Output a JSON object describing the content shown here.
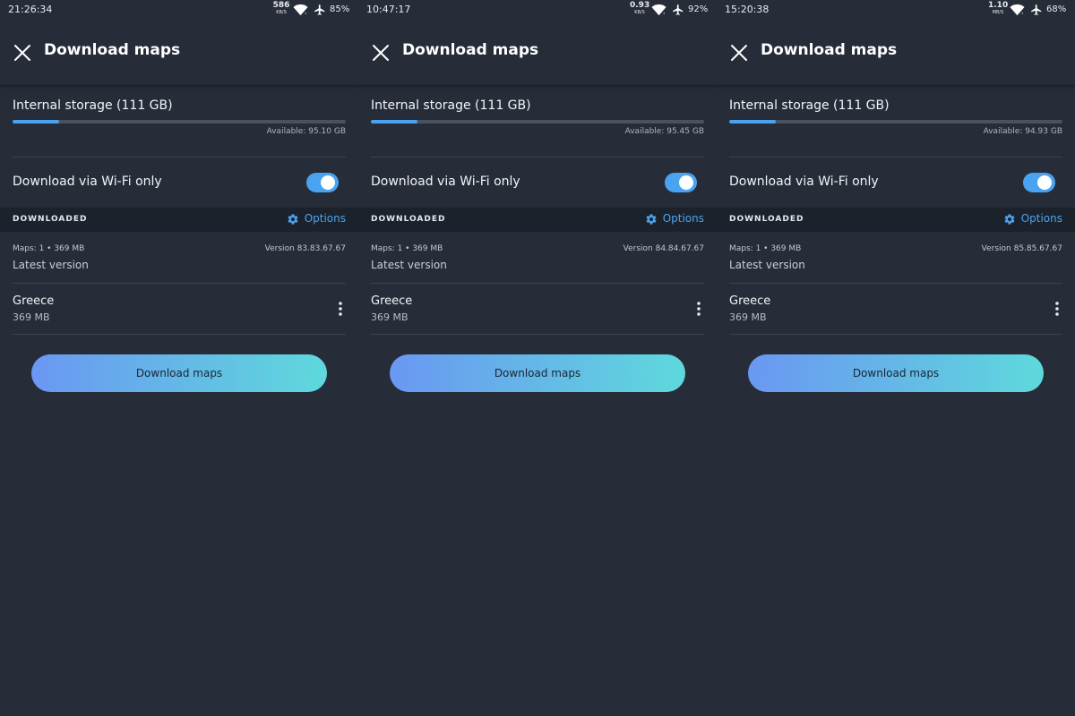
{
  "panels": [
    {
      "status": {
        "time": "21:26:34",
        "net_value": "586",
        "net_unit": "KB/S",
        "battery": "85%"
      },
      "header": {
        "title": "Download maps"
      },
      "storage": {
        "label": "Internal storage (111 GB)",
        "used_fraction": 0.14,
        "available": "Available: 95.10 GB"
      },
      "wifi_only": {
        "label": "Download via Wi-Fi only",
        "enabled": true
      },
      "downloaded": {
        "section_title": "DOWNLOADED",
        "options_label": "Options",
        "maps_meta": "Maps: 1 • 369 MB",
        "version": "Version 83.83.67.67",
        "status": "Latest version",
        "items": [
          {
            "name": "Greece",
            "size": "369 MB"
          }
        ]
      },
      "button_label": "Download maps"
    },
    {
      "status": {
        "time": "10:47:17",
        "net_value": "0.93",
        "net_unit": "KB/S",
        "battery": "92%"
      },
      "header": {
        "title": "Download maps"
      },
      "storage": {
        "label": "Internal storage (111 GB)",
        "used_fraction": 0.14,
        "available": "Available: 95.45 GB"
      },
      "wifi_only": {
        "label": "Download via Wi-Fi only",
        "enabled": true
      },
      "downloaded": {
        "section_title": "DOWNLOADED",
        "options_label": "Options",
        "maps_meta": "Maps: 1 • 369 MB",
        "version": "Version 84.84.67.67",
        "status": "Latest version",
        "items": [
          {
            "name": "Greece",
            "size": "369 MB"
          }
        ]
      },
      "button_label": "Download maps"
    },
    {
      "status": {
        "time": "15:20:38",
        "net_value": "1.10",
        "net_unit": "MB/S",
        "battery": "68%"
      },
      "header": {
        "title": "Download maps"
      },
      "storage": {
        "label": "Internal storage (111 GB)",
        "used_fraction": 0.14,
        "available": "Available: 94.93 GB"
      },
      "wifi_only": {
        "label": "Download via Wi-Fi only",
        "enabled": true
      },
      "downloaded": {
        "section_title": "DOWNLOADED",
        "options_label": "Options",
        "maps_meta": "Maps: 1 • 369 MB",
        "version": "Version 85.85.67.67",
        "status": "Latest version",
        "items": [
          {
            "name": "Greece",
            "size": "369 MB"
          }
        ]
      },
      "button_label": "Download maps"
    }
  ],
  "colors": {
    "background": "#262d38",
    "section_header": "#1c222b",
    "accent": "#4aa3f0",
    "button_gradient_start": "#6a97f2",
    "button_gradient_end": "#5ed9dc"
  },
  "icons": [
    "close-icon",
    "wifi-icon",
    "airplane-icon",
    "gear-icon",
    "more-vertical-icon"
  ]
}
